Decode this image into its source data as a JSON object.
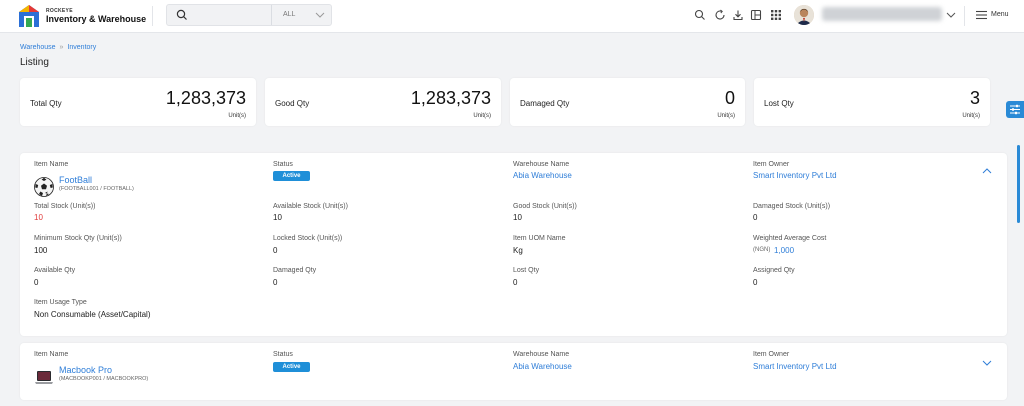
{
  "app": {
    "brand_small": "ROCKEYE",
    "brand_name": "Inventory & Warehouse",
    "menu_label": "Menu"
  },
  "search": {
    "placeholder": "",
    "filter_value": "ALL"
  },
  "breadcrumb": {
    "items": [
      "Warehouse",
      "Inventory"
    ]
  },
  "page": {
    "title": "Listing"
  },
  "summary": [
    {
      "label": "Total Qty",
      "value": "1,283,373",
      "unit": "Unit(s)"
    },
    {
      "label": "Good Qty",
      "value": "1,283,373",
      "unit": "Unit(s)"
    },
    {
      "label": "Damaged Qty",
      "value": "0",
      "unit": "Unit(s)"
    },
    {
      "label": "Lost Qty",
      "value": "3",
      "unit": "Unit(s)"
    }
  ],
  "labels": {
    "item_name": "Item Name",
    "status": "Status",
    "warehouse_name": "Warehouse Name",
    "item_owner": "Item Owner",
    "total_stock": "Total Stock (Unit(s))",
    "available_stock": "Available Stock (Unit(s))",
    "good_stock": "Good Stock (Unit(s))",
    "damaged_stock": "Damaged Stock (Unit(s))",
    "min_stock": "Minimum Stock Qty (Unit(s))",
    "locked_stock": "Locked Stock (Unit(s))",
    "uom": "Item UOM Name",
    "wac": "Weighted Average Cost",
    "available_qty": "Available Qty",
    "damaged_qty": "Damaged Qty",
    "lost_qty": "Lost Qty",
    "assigned_qty": "Assigned Qty",
    "usage_type": "Item Usage Type"
  },
  "items": [
    {
      "name": "FootBall",
      "code": "(FOOTBALL001 / FOOTBALL)",
      "status": "Active",
      "warehouse": "Abia Warehouse",
      "owner": "Smart Inventory Pvt Ltd",
      "total_stock": "10",
      "available_stock": "10",
      "good_stock": "10",
      "damaged_stock": "0",
      "min_stock": "100",
      "locked_stock": "0",
      "uom": "Kg",
      "wac_currency": "(NGN)",
      "wac_value": "1,000",
      "available_qty": "0",
      "damaged_qty": "0",
      "lost_qty": "0",
      "assigned_qty": "0",
      "usage_type": "Non Consumable (Asset/Capital)",
      "expanded": true
    },
    {
      "name": "Macbook Pro",
      "code": "(MACBOOKP001 / MACBOOKPRO)",
      "status": "Active",
      "warehouse": "Abia Warehouse",
      "owner": "Smart Inventory Pvt Ltd",
      "expanded": false
    }
  ],
  "colors": {
    "accent": "#2f7ed8",
    "badge": "#1f8fd8",
    "alert": "#e03b3b"
  },
  "icons": [
    "search-icon",
    "chevron-down-icon",
    "refresh-icon",
    "download-icon",
    "layout-icon",
    "apps-grid-icon",
    "menu-icon",
    "filter-sliders-icon",
    "chevron-up-icon"
  ]
}
